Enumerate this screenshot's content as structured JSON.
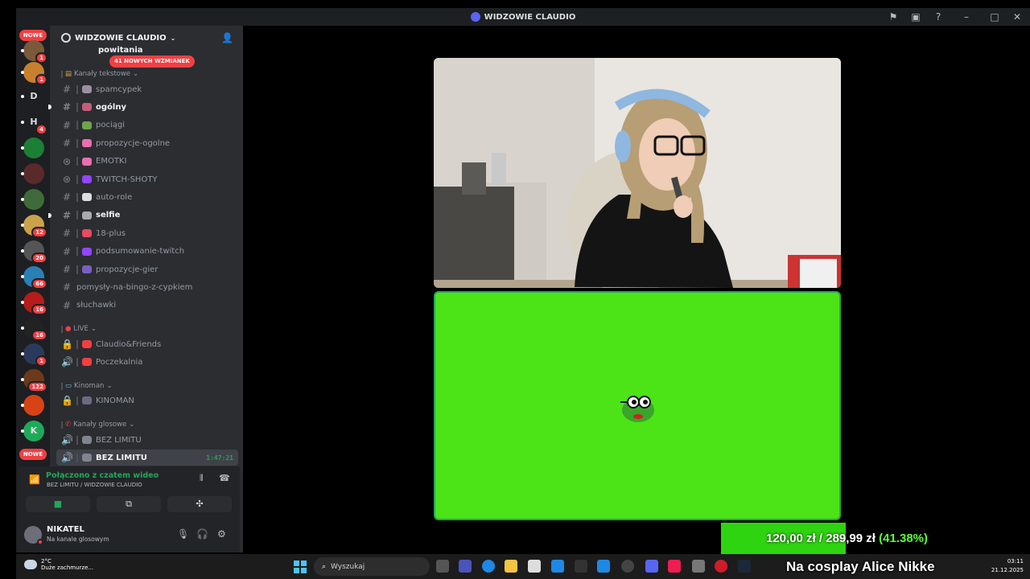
{
  "window": {
    "title": "WIDZOWIE CLAUDIO"
  },
  "servers": {
    "nowe_top": "NOWE",
    "nowe_bottom": "NOWE",
    "items": [
      {
        "label": "",
        "badge": "1",
        "color": "#7a5a3a"
      },
      {
        "label": "",
        "badge": "1",
        "color": "#c7802e"
      },
      {
        "label": "D",
        "badge": "",
        "color": "#1e1f22"
      },
      {
        "label": "H",
        "badge": "4",
        "color": "#1e1f22"
      },
      {
        "label": "",
        "badge": "",
        "color": "#1b7f35"
      },
      {
        "label": "",
        "badge": "",
        "color": "#5a2a2a"
      },
      {
        "label": "",
        "badge": "",
        "color": "#3f6b3a"
      },
      {
        "label": "",
        "badge": "12",
        "color": "#c9a24a"
      },
      {
        "label": "",
        "badge": "20",
        "color": "#555"
      },
      {
        "label": "",
        "badge": "66",
        "color": "#2a7fb5"
      },
      {
        "label": "",
        "badge": "16",
        "color": "#b71c1c"
      },
      {
        "label": "",
        "badge": "16",
        "color": "#222"
      },
      {
        "label": "",
        "badge": "1",
        "color": "#2a3a5c"
      },
      {
        "label": "",
        "badge": "122",
        "color": "#6b3a1a"
      },
      {
        "label": "",
        "badge": "",
        "color": "#d84315"
      },
      {
        "label": "K",
        "badge": "",
        "color": "#1faa59"
      }
    ]
  },
  "guild": {
    "name": "WIDZOWIE CLAUDIO",
    "mentions_pill": "41 NOWYCH WZMIANEK",
    "partial_channel": "powitania",
    "categories": {
      "text": "Kanały tekstowe",
      "live": "LIVE",
      "kinoman": "Kinoman",
      "voice": "Kanały glosowe"
    },
    "channels": [
      {
        "name": "spamcypek",
        "type": "text",
        "bold": false,
        "emoji": "#9b8fa3"
      },
      {
        "name": "ogólny",
        "type": "text",
        "bold": true,
        "emoji": "#c25e7a"
      },
      {
        "name": "pociągi",
        "type": "text",
        "bold": false,
        "emoji": "#6da34d"
      },
      {
        "name": "propozycje-ogolne",
        "type": "text",
        "bold": false,
        "emoji": "#e86fb0"
      },
      {
        "name": "EMOTKI",
        "type": "stage",
        "bold": false,
        "emoji": "#e86fb0"
      },
      {
        "name": "TWITCH-SHOTY",
        "type": "stage",
        "bold": false,
        "emoji": "#9146ff"
      },
      {
        "name": "auto-role",
        "type": "text",
        "bold": false,
        "emoji": "#ddd"
      },
      {
        "name": "selfie",
        "type": "text",
        "bold": true,
        "emoji": "#aaa"
      },
      {
        "name": "18-plus",
        "type": "text",
        "bold": false,
        "emoji": "#e84a5f"
      },
      {
        "name": "podsumowanie-twitch",
        "type": "text",
        "bold": false,
        "emoji": "#9146ff"
      },
      {
        "name": "propozycje-gier",
        "type": "text",
        "bold": false,
        "emoji": "#7a5fbf"
      },
      {
        "name": "pomysły-na-bingo-z-cypkiem",
        "type": "text",
        "bold": false,
        "emoji": ""
      },
      {
        "name": "słuchawki",
        "type": "text",
        "bold": false,
        "emoji": ""
      }
    ],
    "live_channels": [
      {
        "name": "Claudio&Friends"
      },
      {
        "name": "Poczekalnia"
      }
    ],
    "kinoman_channels": [
      {
        "name": "KINOMAN"
      }
    ],
    "voice_channels": [
      {
        "name": "BEZ LIMITU",
        "active": false,
        "time": ""
      },
      {
        "name": "BEZ LIMITU",
        "active": true,
        "time": "1:47:21"
      }
    ]
  },
  "voice_panel": {
    "status": "Połączono z czatem wideo",
    "location": "BEZ LIMITU / WIDZOWIE CLAUDIO"
  },
  "user": {
    "name": "NIKATEL",
    "status": "Na kanale glosowym"
  },
  "overlay": {
    "amount": "120,00 zł",
    "divider": "/",
    "goal": "289,99 zł",
    "percent": "(41.38%)",
    "progress_percent": 41.38,
    "caption": "Na cosplay Alice Nikke"
  },
  "taskbar": {
    "temp": "2°C",
    "weather": "Duże zachmurze...",
    "search_placeholder": "Wyszukaj",
    "time": "03:11",
    "date": "21.12.2025"
  }
}
